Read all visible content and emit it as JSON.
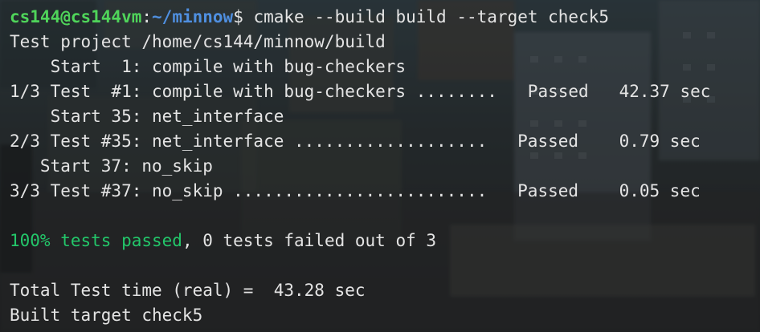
{
  "terminal": {
    "prompt": {
      "user_host": "cs144@cs144vm",
      "colon": ":",
      "path": "~/minnow",
      "symbol": "$",
      "command": " cmake --build build --target check5"
    },
    "lines": [
      "Test project /home/cs144/minnow/build",
      "    Start  1: compile with bug-checkers",
      "1/3 Test  #1: compile with bug-checkers ........   Passed   42.37 sec",
      "    Start 35: net_interface",
      "2/3 Test #35: net_interface ...................   Passed    0.79 sec",
      "   Start 37: no_skip",
      "3/3 Test #37: no_skip .........................   Passed    0.05 sec",
      "",
      "",
      "",
      "Total Test time (real) =  43.28 sec",
      "Built target check5"
    ],
    "summary": {
      "passed_text": "100% tests passed",
      "rest_text": ", 0 tests failed out of 3"
    }
  },
  "colors": {
    "user_host": "#4fd45a",
    "path": "#4f8fe0",
    "text": "#e4e4e4",
    "success": "#23c76a"
  }
}
